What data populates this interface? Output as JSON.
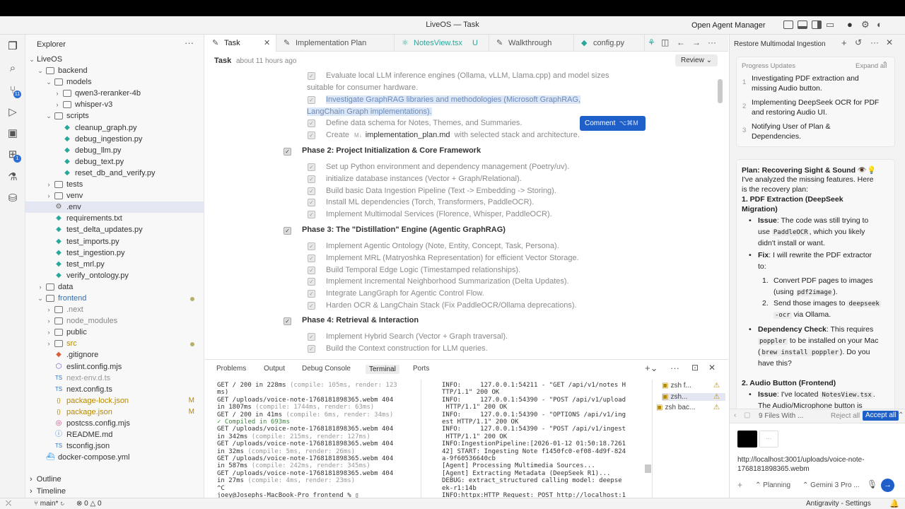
{
  "window": {
    "title": "LiveOS — Task",
    "open_agent_manager": "Open Agent Manager"
  },
  "sidebar": {
    "title": "Explorer",
    "more": "···",
    "root": "LiveOS",
    "rows": [
      {
        "t": "backend",
        "d": 1,
        "k": "folder",
        "open": true
      },
      {
        "t": "models",
        "d": 2,
        "k": "folder",
        "open": true
      },
      {
        "t": "qwen3-reranker-4b",
        "d": 3,
        "k": "folder",
        "open": false
      },
      {
        "t": "whisper-v3",
        "d": 3,
        "k": "folder",
        "open": false
      },
      {
        "t": "scripts",
        "d": 2,
        "k": "folder",
        "open": true
      },
      {
        "t": "cleanup_graph.py",
        "d": 3,
        "k": "py"
      },
      {
        "t": "debug_ingestion.py",
        "d": 3,
        "k": "py"
      },
      {
        "t": "debug_llm.py",
        "d": 3,
        "k": "py"
      },
      {
        "t": "debug_text.py",
        "d": 3,
        "k": "py"
      },
      {
        "t": "reset_db_and_verify.py",
        "d": 3,
        "k": "py"
      },
      {
        "t": "tests",
        "d": 2,
        "k": "folder",
        "open": false
      },
      {
        "t": "venv",
        "d": 2,
        "k": "folder",
        "open": false
      },
      {
        "t": ".env",
        "d": 2,
        "k": "gear",
        "sel": true
      },
      {
        "t": "requirements.txt",
        "d": 2,
        "k": "py"
      },
      {
        "t": "test_delta_updates.py",
        "d": 2,
        "k": "py"
      },
      {
        "t": "test_imports.py",
        "d": 2,
        "k": "py"
      },
      {
        "t": "test_ingestion.py",
        "d": 2,
        "k": "py"
      },
      {
        "t": "test_mrl.py",
        "d": 2,
        "k": "py"
      },
      {
        "t": "verify_ontology.py",
        "d": 2,
        "k": "py"
      },
      {
        "t": "data",
        "d": 1,
        "k": "folder",
        "open": false
      },
      {
        "t": "frontend",
        "d": 1,
        "k": "folder",
        "open": true,
        "color": "#2c6fb6",
        "dot": true
      },
      {
        "t": ".next",
        "d": 2,
        "k": "folder",
        "open": false,
        "color": "#888"
      },
      {
        "t": "node_modules",
        "d": 2,
        "k": "folder",
        "open": false,
        "color": "#888"
      },
      {
        "t": "public",
        "d": 2,
        "k": "folder",
        "open": false
      },
      {
        "t": "src",
        "d": 2,
        "k": "folder",
        "open": false,
        "color": "#b58a00",
        "dot": true
      },
      {
        "t": ".gitignore",
        "d": 2,
        "k": "git"
      },
      {
        "t": "eslint.config.mjs",
        "d": 2,
        "k": "eslint"
      },
      {
        "t": "next-env.d.ts",
        "d": 2,
        "k": "ts",
        "color": "#999"
      },
      {
        "t": "next.config.ts",
        "d": 2,
        "k": "ts"
      },
      {
        "t": "package-lock.json",
        "d": 2,
        "k": "json",
        "color": "#b58a00",
        "mark": "M"
      },
      {
        "t": "package.json",
        "d": 2,
        "k": "json",
        "color": "#b58a00",
        "mark": "M"
      },
      {
        "t": "postcss.config.mjs",
        "d": 2,
        "k": "css"
      },
      {
        "t": "README.md",
        "d": 2,
        "k": "md"
      },
      {
        "t": "tsconfig.json",
        "d": 2,
        "k": "ts"
      },
      {
        "t": "docker-compose.yml",
        "d": 1,
        "k": "docker"
      }
    ],
    "outline": "Outline",
    "timeline": "Timeline"
  },
  "tabs": [
    {
      "label": "Task",
      "active": true
    },
    {
      "label": "Implementation Plan"
    },
    {
      "label": "NotesView.tsx",
      "mark": "U"
    },
    {
      "label": "Walkthrough"
    },
    {
      "label": "config.py"
    }
  ],
  "task": {
    "title": "Task",
    "time": "about 11 hours ago",
    "review": "Review",
    "comment": "Comment",
    "comment_key": "⌥⌘M",
    "top_items": [
      {
        "text": "Evaluate local LLM inference engines (Ollama, vLLM, Llama.cpp) and model sizes"
      },
      {
        "text": "suitable for consumer hardware.",
        "cont": true
      },
      {
        "text": "Investigate GraphRAG libraries and methodologies (Microsoft GraphRAG,",
        "hl": true
      },
      {
        "text": "LangChain Graph implementations).",
        "cont": true,
        "hl": true
      },
      {
        "text": "Define data schema for Notes, Themes, and Summaries."
      },
      {
        "text": "Create",
        "file": "implementation_plan.md",
        "after": "with selected stack and architecture."
      }
    ],
    "phases": [
      {
        "title": "Phase 2: Project Initialization & Core Framework",
        "items": [
          "Set up Python environment and dependency management (Poetry/uv).",
          "initialize database instances (Vector + Graph/Relational).",
          "Build basic Data Ingestion Pipeline (Text -> Embedding -> Storing).",
          "Install ML dependencies (Torch, Transformers, PaddleOCR).",
          "Implement Multimodal Services (Florence, Whisper, PaddleOCR)."
        ]
      },
      {
        "title": "Phase 3: The \"Distillation\" Engine (Agentic GraphRAG)",
        "items": [
          "Implement Agentic Ontology (Note, Entity, Concept, Task, Persona).",
          "Implement MRL (Matryoshka Representation) for efficient Vector Storage.",
          "Build Temporal Edge Logic (Timestamped relationships).",
          "Implement Incremental Neighborhood Summarization (Delta Updates).",
          "Integrate LangGraph for Agentic Control Flow.",
          "Harden OCR & LangChain Stack (Fix PaddleOCR/Ollama deprecations)."
        ]
      },
      {
        "title": "Phase 4: Retrieval & Interaction",
        "items": [
          "Implement Hybrid Search (Vector + Graph traversal).",
          "Build the Context construction for LLM queries."
        ]
      }
    ]
  },
  "panel": {
    "tabs": [
      "Problems",
      "Output",
      "Debug Console",
      "Terminal",
      "Ports"
    ],
    "active": "Terminal",
    "term_left": [
      [
        "GET / 200 in 228ms ",
        "(compile: 105ms, render: 123"
      ],
      [
        "ms)",
        ""
      ],
      [
        "GET /uploads/voice-note-1768181898365.webm 404",
        ""
      ],
      [
        "in 1807ms ",
        "(compile: 1744ms, render: 63ms)"
      ],
      [
        "GET / 200 in 41ms ",
        "(compile: 6ms, render: 34ms)"
      ],
      [
        "✓ Compiled in 693ms",
        ""
      ],
      [
        "GET /uploads/voice-note-1768181898365.webm 404",
        ""
      ],
      [
        "in 342ms ",
        "(compile: 215ms, render: 127ms)"
      ],
      [
        "GET /uploads/voice-note-1768181898365.webm 404",
        ""
      ],
      [
        "in 32ms ",
        "(compile: 5ms, render: 26ms)"
      ],
      [
        "GET /uploads/voice-note-1768181898365.webm 404",
        ""
      ],
      [
        "in 587ms ",
        "(compile: 242ms, render: 345ms)"
      ],
      [
        "GET /uploads/voice-note-1768181898365.webm 404",
        ""
      ],
      [
        "in 27ms ",
        "(compile: 4ms, render: 23ms)"
      ],
      [
        "^C",
        ""
      ],
      [
        "joey@Josephs-MacBook-Pro frontend % ▯",
        ""
      ]
    ],
    "term_right": [
      "INFO:     127.0.0.1:54211 - \"GET /api/v1/notes H",
      "TTP/1.1\" 200 OK",
      "INFO:     127.0.0.1:54390 - \"POST /api/v1/upload",
      " HTTP/1.1\" 200 OK",
      "INFO:     127.0.0.1:54390 - \"OPTIONS /api/v1/ing",
      "est HTTP/1.1\" 200 OK",
      "INFO:     127.0.0.1:54390 - \"POST /api/v1/ingest",
      " HTTP/1.1\" 200 OK",
      "INFO:IngestionPipeline:[2026-01-12 01:50:18.7261",
      "42] START: Ingesting Note f1450fc0-ef08-4d9f-824",
      "a-9f60536640cb",
      "[Agent] Processing Multimedia Sources...",
      "[Agent] Extracting Metadata (DeepSeek R1)...",
      "DEBUG: extract_structured calling model: deepse",
      "ek-r1:14b",
      "INFO:httpx:HTTP Request: POST http://localhost:1"
    ],
    "terms": [
      "zsh f...",
      "zsh...",
      "zsh bac..."
    ]
  },
  "agent": {
    "title": "Restore Multimodal Ingestion",
    "progress": "Progress Updates",
    "expand": "Expand all",
    "steps": [
      [
        "Investigating PDF extraction and",
        "missing Audio button."
      ],
      [
        "Implementing DeepSeek OCR for PDF",
        "and restoring Audio UI."
      ],
      [
        "Notifying User of Plan &",
        "Dependencies."
      ]
    ],
    "plan_title": "Plan: Recovering Sight & Sound 👁️💡",
    "plan_intro": [
      "I've analyzed the missing features. Here",
      "is the recovery plan:"
    ],
    "h1": [
      "1. PDF Extraction (DeepSeek",
      "Migration)"
    ],
    "issue_label": "Issue",
    "issue1": [
      ": The code was still trying to",
      "use ",
      ", which you likely",
      "didn't install or want."
    ],
    "paddle": "PaddleOCR",
    "fix_label": "Fix",
    "fix1": [
      ": I will rewrite the PDF extractor",
      "to:"
    ],
    "sub1": [
      "Convert PDF pages to images",
      "(using ",
      ")."
    ],
    "pdf2image": "pdf2image",
    "sub2": [
      "Send those images to ",
      "via Ollama."
    ],
    "deepseek": [
      "deepseek",
      "-ocr"
    ],
    "dep_label": "Dependency Check",
    "dep": [
      ": This requires",
      "to be installed on your Mac",
      "). Do you",
      "have this?"
    ],
    "poppler": "poppler",
    "brew": "brew install poppler",
    "h2": "2. Audio Button (Frontend)",
    "issue2": [
      ": I've located",
      ". ",
      "The Audio/Microphone button is"
    ],
    "notesview": "NotesView.tsx",
    "files": "9 Files With ...",
    "reject": "Reject all",
    "accept": "Accept all",
    "url": [
      "http://localhost:3001/uploads/voice-note-",
      "1768181898365.webm"
    ],
    "mode": "Planning",
    "model": "Gemini 3 Pro ..."
  },
  "status": {
    "branch": "main*",
    "errors": "0",
    "warnings": "0",
    "right": "Antigravity - Settings"
  },
  "colors": {
    "accent": "#1f5fc9",
    "py": "#2aa79b"
  }
}
